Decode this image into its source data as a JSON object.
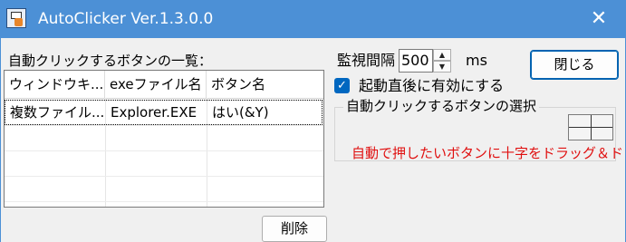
{
  "window": {
    "title": "AutoClicker Ver.1.3.0.0"
  },
  "colors": {
    "titlebar": "#4c90d6",
    "accent": "#0067c0",
    "hint_text": "#e01010"
  },
  "list": {
    "label": "自動クリックするボタンの一覧：",
    "columns": [
      "ウィンドウキ...",
      "exeファイル名",
      "ボタン名"
    ],
    "rows": [
      [
        "複数ファイル...",
        "Explorer.EXE",
        "はい(&Y)"
      ]
    ]
  },
  "buttons": {
    "delete": "削除",
    "close": "閉じる"
  },
  "monitor": {
    "label": "監視間隔",
    "value": "500",
    "unit": "ms"
  },
  "startup": {
    "label": "起動直後に有効にする",
    "checked": true
  },
  "select_group": {
    "title": "自動クリックするボタンの選択",
    "hint": "自動で押したいボタンに十字をドラッグ＆ド"
  },
  "icons": {
    "app": "autoclicker-app-icon",
    "close": "close-icon",
    "check": "checkmark-icon",
    "spin_up": "arrow-up-icon",
    "spin_down": "arrow-down-icon",
    "crosshair": "crosshair-target-icon"
  }
}
